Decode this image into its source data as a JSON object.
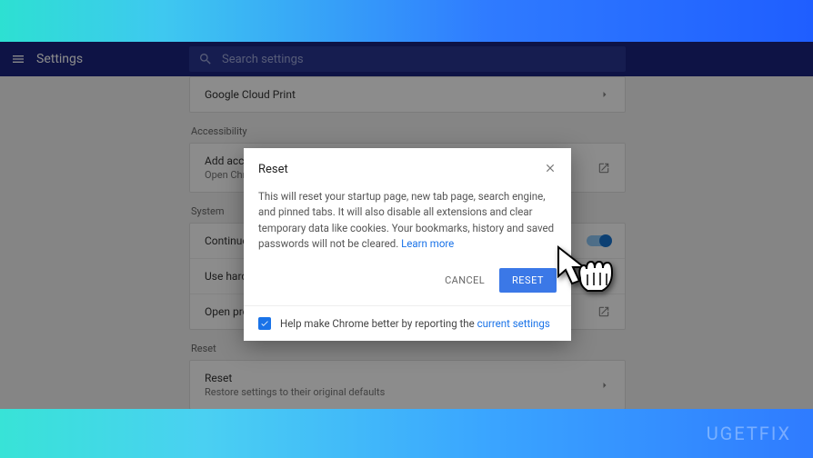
{
  "header": {
    "title": "Settings",
    "search_placeholder": "Search settings"
  },
  "sections": {
    "printing_row": "Google Cloud Print",
    "accessibility_label": "Accessibility",
    "accessibility_title": "Add accessibility features",
    "accessibility_sub": "Open Chrome Web Store",
    "system_label": "System",
    "system_row1": "Continue running background apps when Google Chrome is closed",
    "system_row2": "Use hardware acceleration when available",
    "system_row3": "Open proxy settings",
    "reset_label": "Reset",
    "reset_title": "Reset",
    "reset_sub": "Restore settings to their original defaults"
  },
  "dialog": {
    "title": "Reset",
    "body_pre": "This will reset your startup page, new tab page, search engine, and pinned tabs. It will also disable all extensions and clear temporary data like cookies. Your bookmarks, history and saved passwords will not be cleared. ",
    "learn_more": "Learn more",
    "cancel": "CANCEL",
    "reset": "RESET",
    "help_pre": "Help make Chrome better by reporting the ",
    "help_link": "current settings"
  },
  "watermark": "UGETFIX"
}
